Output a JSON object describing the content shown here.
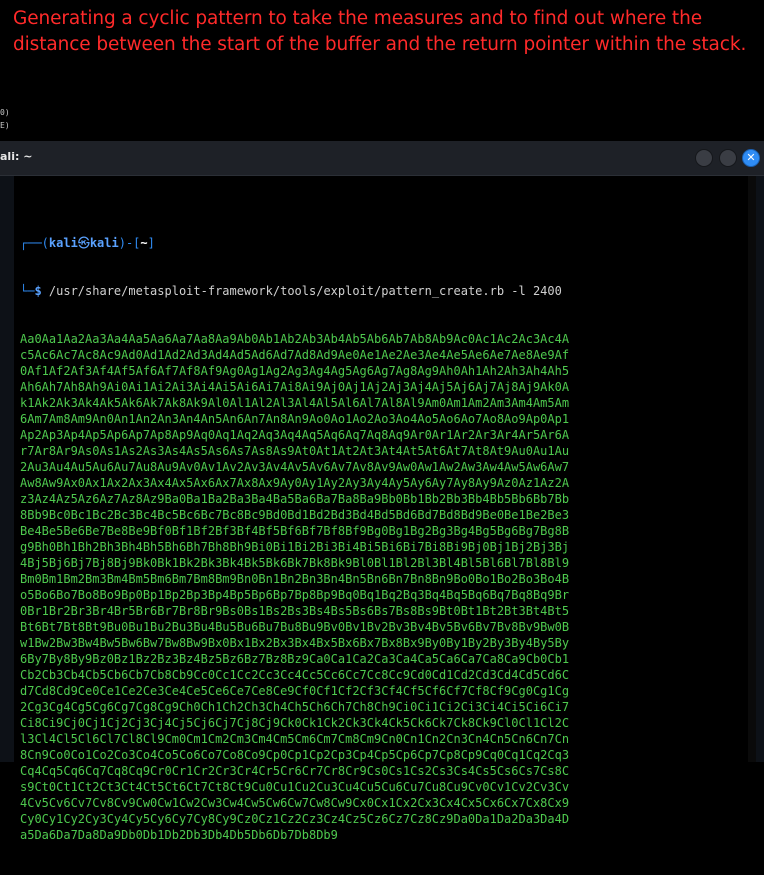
{
  "caption": {
    "line1": "Generating a cyclic pattern to take the measures and to find out where the",
    "line2": "distance between the start of the buffer and the return pointer within the stack."
  },
  "background_fragments": [
    "0)",
    "E)"
  ],
  "window": {
    "title": "ali: ~",
    "buttons": {
      "minimize": "",
      "maximize": "",
      "close": "✕"
    }
  },
  "terminal": {
    "prompt": {
      "open": "┌──(",
      "user": "kali",
      "at": "㉿",
      "host": "kali",
      "mid": ")-[",
      "dir": "~",
      "close": "]"
    },
    "prompt2": {
      "corner": "└─",
      "sign": "$",
      "command": " /usr/share/metasploit-framework/tools/exploit/pattern_create.rb -l 2400"
    },
    "output": [
      "Aa0Aa1Aa2Aa3Aa4Aa5Aa6Aa7Aa8Aa9Ab0Ab1Ab2Ab3Ab4Ab5Ab6Ab7Ab8Ab9Ac0Ac1Ac2Ac3Ac4A",
      "c5Ac6Ac7Ac8Ac9Ad0Ad1Ad2Ad3Ad4Ad5Ad6Ad7Ad8Ad9Ae0Ae1Ae2Ae3Ae4Ae5Ae6Ae7Ae8Ae9Af",
      "0Af1Af2Af3Af4Af5Af6Af7Af8Af9Ag0Ag1Ag2Ag3Ag4Ag5Ag6Ag7Ag8Ag9Ah0Ah1Ah2Ah3Ah4Ah5",
      "Ah6Ah7Ah8Ah9Ai0Ai1Ai2Ai3Ai4Ai5Ai6Ai7Ai8Ai9Aj0Aj1Aj2Aj3Aj4Aj5Aj6Aj7Aj8Aj9Ak0A",
      "k1Ak2Ak3Ak4Ak5Ak6Ak7Ak8Ak9Al0Al1Al2Al3Al4Al5Al6Al7Al8Al9Am0Am1Am2Am3Am4Am5Am",
      "6Am7Am8Am9An0An1An2An3An4An5An6An7An8An9Ao0Ao1Ao2Ao3Ao4Ao5Ao6Ao7Ao8Ao9Ap0Ap1",
      "Ap2Ap3Ap4Ap5Ap6Ap7Ap8Ap9Aq0Aq1Aq2Aq3Aq4Aq5Aq6Aq7Aq8Aq9Ar0Ar1Ar2Ar3Ar4Ar5Ar6A",
      "r7Ar8Ar9As0As1As2As3As4As5As6As7As8As9At0At1At2At3At4At5At6At7At8At9Au0Au1Au",
      "2Au3Au4Au5Au6Au7Au8Au9Av0Av1Av2Av3Av4Av5Av6Av7Av8Av9Aw0Aw1Aw2Aw3Aw4Aw5Aw6Aw7",
      "Aw8Aw9Ax0Ax1Ax2Ax3Ax4Ax5Ax6Ax7Ax8Ax9Ay0Ay1Ay2Ay3Ay4Ay5Ay6Ay7Ay8Ay9Az0Az1Az2A",
      "z3Az4Az5Az6Az7Az8Az9Ba0Ba1Ba2Ba3Ba4Ba5Ba6Ba7Ba8Ba9Bb0Bb1Bb2Bb3Bb4Bb5Bb6Bb7Bb",
      "8Bb9Bc0Bc1Bc2Bc3Bc4Bc5Bc6Bc7Bc8Bc9Bd0Bd1Bd2Bd3Bd4Bd5Bd6Bd7Bd8Bd9Be0Be1Be2Be3",
      "Be4Be5Be6Be7Be8Be9Bf0Bf1Bf2Bf3Bf4Bf5Bf6Bf7Bf8Bf9Bg0Bg1Bg2Bg3Bg4Bg5Bg6Bg7Bg8B",
      "g9Bh0Bh1Bh2Bh3Bh4Bh5Bh6Bh7Bh8Bh9Bi0Bi1Bi2Bi3Bi4Bi5Bi6Bi7Bi8Bi9Bj0Bj1Bj2Bj3Bj",
      "4Bj5Bj6Bj7Bj8Bj9Bk0Bk1Bk2Bk3Bk4Bk5Bk6Bk7Bk8Bk9Bl0Bl1Bl2Bl3Bl4Bl5Bl6Bl7Bl8Bl9",
      "Bm0Bm1Bm2Bm3Bm4Bm5Bm6Bm7Bm8Bm9Bn0Bn1Bn2Bn3Bn4Bn5Bn6Bn7Bn8Bn9Bo0Bo1Bo2Bo3Bo4B",
      "o5Bo6Bo7Bo8Bo9Bp0Bp1Bp2Bp3Bp4Bp5Bp6Bp7Bp8Bp9Bq0Bq1Bq2Bq3Bq4Bq5Bq6Bq7Bq8Bq9Br",
      "0Br1Br2Br3Br4Br5Br6Br7Br8Br9Bs0Bs1Bs2Bs3Bs4Bs5Bs6Bs7Bs8Bs9Bt0Bt1Bt2Bt3Bt4Bt5",
      "Bt6Bt7Bt8Bt9Bu0Bu1Bu2Bu3Bu4Bu5Bu6Bu7Bu8Bu9Bv0Bv1Bv2Bv3Bv4Bv5Bv6Bv7Bv8Bv9Bw0B",
      "w1Bw2Bw3Bw4Bw5Bw6Bw7Bw8Bw9Bx0Bx1Bx2Bx3Bx4Bx5Bx6Bx7Bx8Bx9By0By1By2By3By4By5By",
      "6By7By8By9Bz0Bz1Bz2Bz3Bz4Bz5Bz6Bz7Bz8Bz9Ca0Ca1Ca2Ca3Ca4Ca5Ca6Ca7Ca8Ca9Cb0Cb1",
      "Cb2Cb3Cb4Cb5Cb6Cb7Cb8Cb9Cc0Cc1Cc2Cc3Cc4Cc5Cc6Cc7Cc8Cc9Cd0Cd1Cd2Cd3Cd4Cd5Cd6C",
      "d7Cd8Cd9Ce0Ce1Ce2Ce3Ce4Ce5Ce6Ce7Ce8Ce9Cf0Cf1Cf2Cf3Cf4Cf5Cf6Cf7Cf8Cf9Cg0Cg1Cg",
      "2Cg3Cg4Cg5Cg6Cg7Cg8Cg9Ch0Ch1Ch2Ch3Ch4Ch5Ch6Ch7Ch8Ch9Ci0Ci1Ci2Ci3Ci4Ci5Ci6Ci7",
      "Ci8Ci9Cj0Cj1Cj2Cj3Cj4Cj5Cj6Cj7Cj8Cj9Ck0Ck1Ck2Ck3Ck4Ck5Ck6Ck7Ck8Ck9Cl0Cl1Cl2C",
      "l3Cl4Cl5Cl6Cl7Cl8Cl9Cm0Cm1Cm2Cm3Cm4Cm5Cm6Cm7Cm8Cm9Cn0Cn1Cn2Cn3Cn4Cn5Cn6Cn7Cn",
      "8Cn9Co0Co1Co2Co3Co4Co5Co6Co7Co8Co9Cp0Cp1Cp2Cp3Cp4Cp5Cp6Cp7Cp8Cp9Cq0Cq1Cq2Cq3",
      "Cq4Cq5Cq6Cq7Cq8Cq9Cr0Cr1Cr2Cr3Cr4Cr5Cr6Cr7Cr8Cr9Cs0Cs1Cs2Cs3Cs4Cs5Cs6Cs7Cs8C",
      "s9Ct0Ct1Ct2Ct3Ct4Ct5Ct6Ct7Ct8Ct9Cu0Cu1Cu2Cu3Cu4Cu5Cu6Cu7Cu8Cu9Cv0Cv1Cv2Cv3Cv",
      "4Cv5Cv6Cv7Cv8Cv9Cw0Cw1Cw2Cw3Cw4Cw5Cw6Cw7Cw8Cw9Cx0Cx1Cx2Cx3Cx4Cx5Cx6Cx7Cx8Cx9",
      "Cy0Cy1Cy2Cy3Cy4Cy5Cy6Cy7Cy8Cy9Cz0Cz1Cz2Cz3Cz4Cz5Cz6Cz7Cz8Cz9Da0Da1Da2Da3Da4D",
      "a5Da6Da7Da8Da9Db0Db1Db2Db3Db4Db5Db6Db7Db8Db9"
    ]
  },
  "colors": {
    "caption": "#ff2a2a",
    "prompt": "#2f8cf4",
    "output": "#4ec94e",
    "close_button": "#2f8cf4"
  }
}
